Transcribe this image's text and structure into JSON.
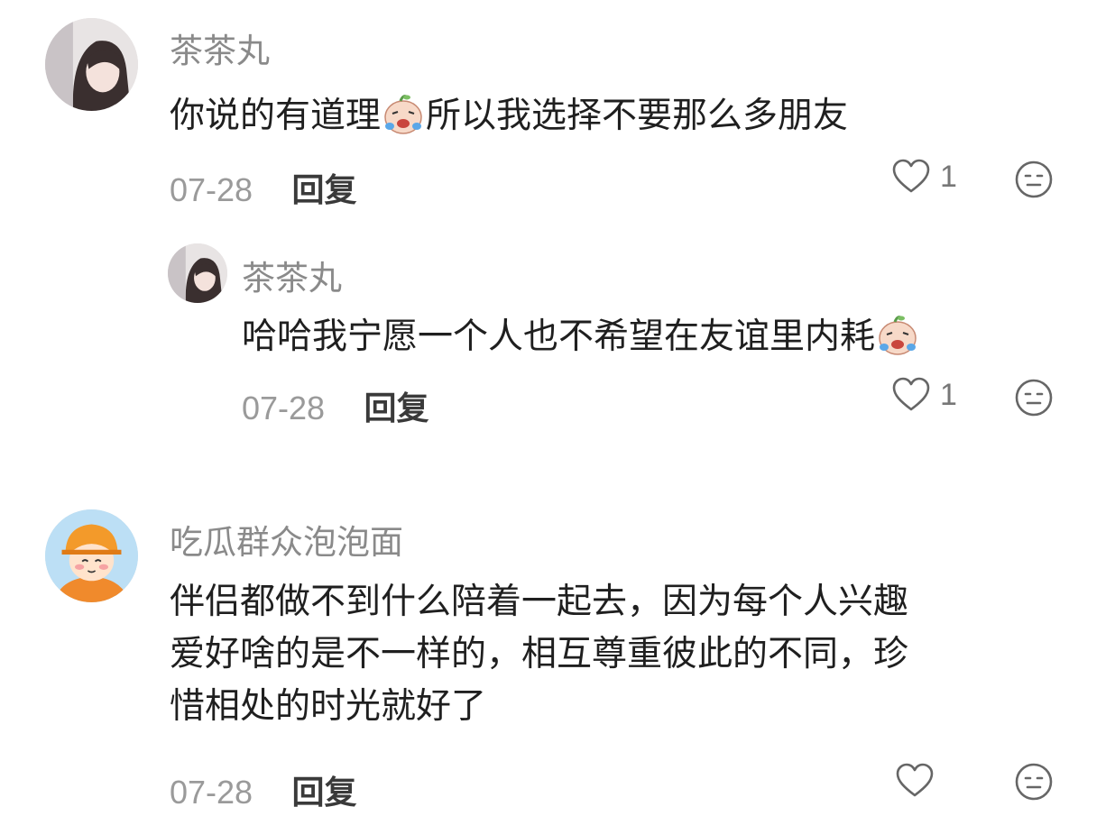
{
  "comments": [
    {
      "username": "茶茶丸",
      "text_before_emoji": "你说的有道理",
      "text_after_emoji": "所以我选择不要那么多朋友",
      "emoji": "crying-laughing-sticker",
      "date": "07-28",
      "reply_label": "回复",
      "likes": "1"
    },
    {
      "username": "茶茶丸",
      "text_before_emoji": "哈哈我宁愿一个人也不希望在友谊里内耗",
      "emoji": "crying-laughing-sticker",
      "date": "07-28",
      "reply_label": "回复",
      "likes": "1"
    },
    {
      "username": "吃瓜群众泡泡面",
      "text_line1": "伴侣都做不到什么陪着一起去，因为每个人兴趣",
      "text_line2": "爱好啥的是不一样的，相互尊重彼此的不同，珍",
      "text_line3": "惜相处的时光就好了",
      "date": "07-28",
      "reply_label": "回复",
      "likes": ""
    }
  ],
  "icons": {
    "like": "heart-outline-icon",
    "dislike": "neutral-face-icon"
  },
  "colors": {
    "username": "#8a8a8a",
    "text": "#1f1f1f",
    "date": "#9a9a9a",
    "icon": "#666666"
  }
}
